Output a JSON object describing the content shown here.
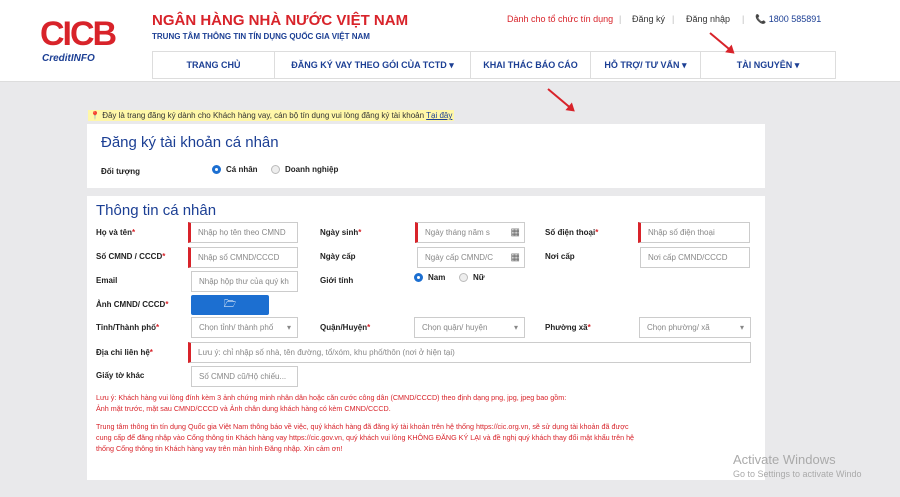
{
  "brand": {
    "logo_text": "CICB",
    "logo_sub": "CreditINFO",
    "bank_name": "NGÂN HÀNG NHÀ NƯỚC VIỆT NAM",
    "bank_sub": "TRUNG TÂM THÔNG TIN TÍN DỤNG QUỐC GIA VIỆT NAM"
  },
  "toplinks": {
    "institution": "Dành cho tổ chức tín dụng",
    "register": "Đăng ký",
    "login": "Đăng nhập",
    "hotline": "📞 1800 585891"
  },
  "nav": [
    {
      "label": "TRANG CHỦ"
    },
    {
      "label": "ĐĂNG KÝ VAY THEO GÓI CỦA TCTD ▾"
    },
    {
      "label": "KHAI THÁC BÁO CÁO"
    },
    {
      "label": "HỖ TRỢ/ TƯ VẤN ▾"
    },
    {
      "label": "TÀI NGUYÊN ▾"
    }
  ],
  "notice": {
    "text": "Đây là trang đăng ký dành cho Khách hàng vay, cán bộ tín dụng vui lòng đăng ký tài khoản",
    "link": "Tại đây"
  },
  "account": {
    "title": "Đăng ký tài khoản cá nhân",
    "subject_label": "Đối tượng",
    "options": [
      "Cá nhân",
      "Doanh nghiệp"
    ],
    "selected": "Cá nhân"
  },
  "personal": {
    "title": "Thông tin cá nhân",
    "fields": {
      "full_name": {
        "label": "Họ và tên",
        "placeholder": "Nhập họ tên theo CMND"
      },
      "dob": {
        "label": "Ngày sinh",
        "placeholder": "Ngày tháng năm s"
      },
      "phone": {
        "label": "Số điện thoại",
        "placeholder": "Nhập số điện thoại"
      },
      "id_number": {
        "label": "Số CMND / CCCD",
        "placeholder": "Nhập số CMND/CCCD"
      },
      "issue_date": {
        "label": "Ngày cấp",
        "placeholder": "Ngày cấp CMND/C"
      },
      "issue_place": {
        "label": "Nơi cấp",
        "placeholder": "Nơi cấp CMND/CCCD"
      },
      "email": {
        "label": "Email",
        "placeholder": "Nhập hộp thư của quý kh"
      },
      "gender": {
        "label": "Giới tính",
        "options": [
          "Nam",
          "Nữ"
        ],
        "selected": "Nam"
      },
      "id_photo": {
        "label": "Ảnh CMND/ CCCD"
      },
      "province": {
        "label": "Tỉnh/Thành phố",
        "placeholder": "Chọn tỉnh/ thành phố"
      },
      "district": {
        "label": "Quận/Huyện",
        "placeholder": "Chọn quận/ huyện"
      },
      "ward": {
        "label": "Phường xã",
        "placeholder": "Chọn phường/ xã"
      },
      "address": {
        "label": "Địa chỉ liên hệ",
        "placeholder": "Lưu ý: chỉ nhập số nhà, tên đường, tổ/xóm, khu phố/thôn (nơi ở hiện tại)"
      },
      "other_docs": {
        "label": "Giấy tờ khác",
        "placeholder": "Số CMND cũ/Hộ chiếu..."
      }
    },
    "note1_line1": "Lưu ý: Khách hàng vui lòng đính kèm 3 ảnh chứng minh nhân dân hoặc căn cước công dân (CMND/CCCD) theo định dạng png, jpg, jpeg bao gồm:",
    "note1_line2": "Ảnh mặt trước, mặt sau CMND/CCCD và Ảnh chân dung khách hàng có kèm CMND/CCCD.",
    "note2_line1": "Trung tâm thông tin tín dụng Quốc gia Việt Nam thông báo về việc, quý khách hàng đã đăng ký tài khoản trên hệ thống https://cic.org.vn, sẽ sử dụng tài khoản đã được",
    "note2_line2": "cung cấp để đăng nhập vào Cổng thông tin Khách hàng vay https://cic.gov.vn, quý khách vui lòng KHÔNG ĐĂNG KÝ LẠI và đề nghị quý khách thay đổi mật khẩu trên hệ",
    "note2_line3": "thống Cổng thông tin Khách hàng vay trên màn hình Đăng nhập. Xin cảm ơn!"
  },
  "watermark": {
    "line1": "Activate Windows",
    "line2": "Go to Settings to activate Windo"
  },
  "colors": {
    "brand_red": "#d8232a",
    "brand_blue": "#1c3f94",
    "button_blue": "#1c6fd1"
  }
}
